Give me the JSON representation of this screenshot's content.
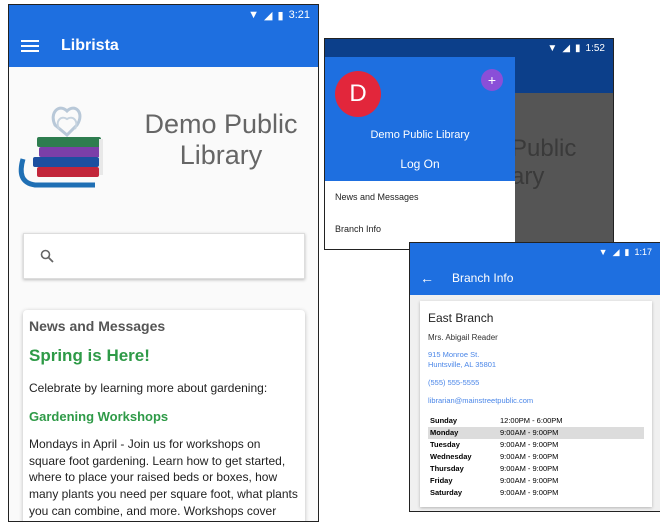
{
  "phone1": {
    "status_time": "3:21",
    "app_title": "Librista",
    "library_name": "Demo Public Library",
    "news": {
      "heading": "News and Messages",
      "title": "Spring is Here!",
      "intro": "Celebrate by learning more about gardening:",
      "subtitle": "Gardening Workshops",
      "body": "Mondays in April - Join us for workshops on square foot gardening. Learn how to get started, where to place your raised beds or boxes, how many plants you need per square foot, what plants you can combine, and more. Workshops cover flowers, vegetables, and"
    }
  },
  "phone2": {
    "status_time": "1:52",
    "avatar_letter": "D",
    "plus_symbol": "+",
    "library_name": "Demo Public Library",
    "logon_label": "Log On",
    "menu": [
      "News and Messages",
      "Branch Info"
    ],
    "bg_text_line1": "Public",
    "bg_text_line2": "ary"
  },
  "phone3": {
    "status_time": "1:17",
    "title": "Branch Info",
    "branch_name": "East Branch",
    "contact": "Mrs. Abigail Reader",
    "address_line1": "915 Monroe St.",
    "address_line2": "Huntsville, AL 35801",
    "phone": "(555) 555-5555",
    "email": "librarian@mainstreetpublic.com",
    "hours": [
      {
        "day": "Sunday",
        "time": "12:00PM - 6:00PM"
      },
      {
        "day": "Monday",
        "time": "9:00AM - 9:00PM"
      },
      {
        "day": "Tuesday",
        "time": "9:00AM - 9:00PM"
      },
      {
        "day": "Wednesday",
        "time": "9:00AM - 9:00PM"
      },
      {
        "day": "Thursday",
        "time": "9:00AM - 9:00PM"
      },
      {
        "day": "Friday",
        "time": "9:00AM - 9:00PM"
      },
      {
        "day": "Saturday",
        "time": "9:00AM - 9:00PM"
      }
    ]
  },
  "colors": {
    "primary": "#1e6fe0",
    "dark_primary": "#0c3f8a",
    "accent_green": "#2e9a47",
    "avatar_red": "#e2263b",
    "fab_purple": "#8a4fd8",
    "link_blue": "#4a86e8"
  },
  "icons": {
    "menu": "hamburger-icon",
    "search": "search-icon",
    "back": "arrow-left-icon",
    "add": "plus-icon",
    "status": [
      "wifi-icon",
      "signal-icon",
      "battery-icon"
    ]
  }
}
